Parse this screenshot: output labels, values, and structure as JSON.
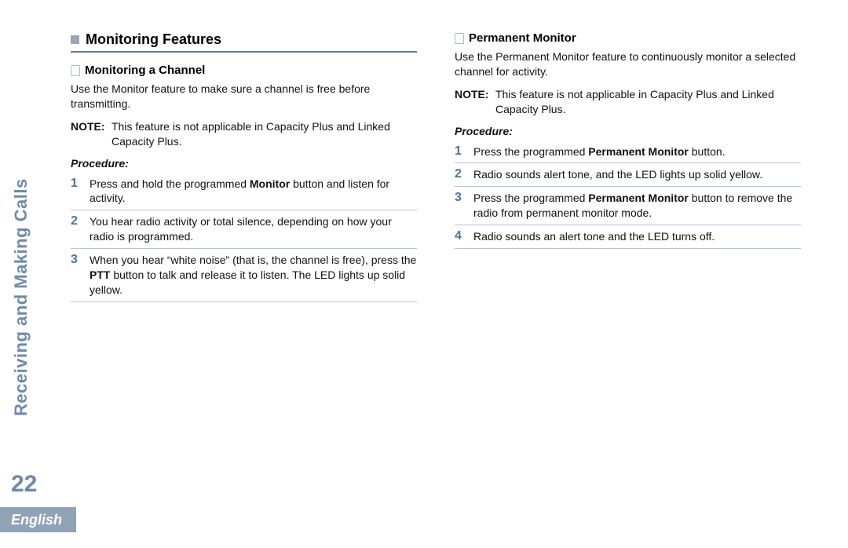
{
  "sideLabel": "Receiving and Making Calls",
  "pageNumber": "22",
  "language": "English",
  "left": {
    "sectionTitle": "Monitoring Features",
    "sub1": {
      "title": "Monitoring a Channel",
      "body": "Use the Monitor feature to make sure a channel is free before transmitting.",
      "noteLabel": "NOTE:",
      "noteText": "This feature is not applicable in Capacity Plus and Linked Capacity Plus.",
      "procLabel": "Procedure:",
      "steps": {
        "n1": "1",
        "t1a": "Press and hold the programmed ",
        "t1b": "Monitor",
        "t1c": " button and listen for activity.",
        "n2": "2",
        "t2": "You hear radio activity or total silence, depending on how your radio is programmed.",
        "n3": "3",
        "t3a": "When you hear “white noise” (that is, the channel is free), press the ",
        "t3b": "PTT",
        "t3c": " button to talk and release it to listen. The LED lights up solid yellow."
      }
    }
  },
  "right": {
    "sub2": {
      "title": "Permanent Monitor",
      "body": "Use the Permanent Monitor feature to continuously monitor a selected channel for activity.",
      "noteLabel": "NOTE:",
      "noteText": "This feature is not applicable in Capacity Plus and Linked Capacity Plus.",
      "procLabel": "Procedure:",
      "steps": {
        "n1": "1",
        "t1a": "Press the programmed ",
        "t1b": "Permanent Monitor",
        "t1c": " button.",
        "n2": "2",
        "t2": "Radio sounds alert tone, and the LED lights up solid yellow.",
        "n3": "3",
        "t3a": "Press the programmed ",
        "t3b": "Permanent Monitor",
        "t3c": " button to remove the radio from permanent monitor mode.",
        "n4": "4",
        "t4": "Radio sounds an alert tone and the LED turns off."
      }
    }
  }
}
